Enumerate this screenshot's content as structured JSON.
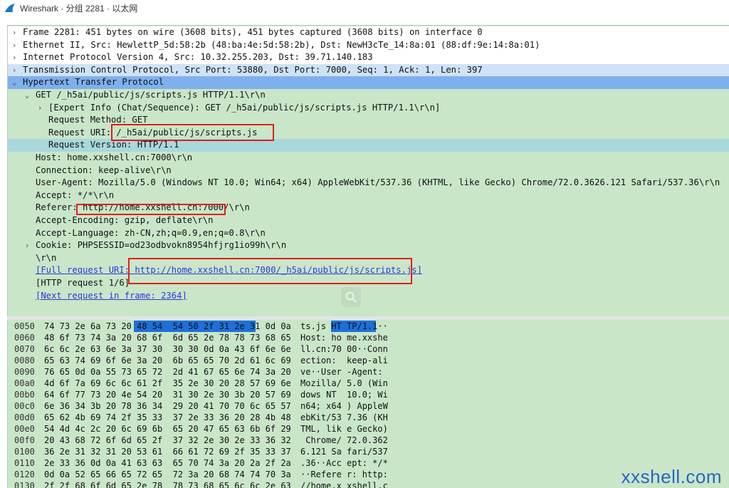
{
  "window": {
    "title": "Wireshark · 分组 2281 · 以太网"
  },
  "tree": {
    "rows": [
      "Frame 2281: 451 bytes on wire (3608 bits), 451 bytes captured (3608 bits) on interface 0",
      "Ethernet II, Src: HewlettP_5d:58:2b (48:ba:4e:5d:58:2b), Dst: NewH3cTe_14:8a:01 (88:df:9e:14:8a:01)",
      "Internet Protocol Version 4, Src: 10.32.255.203, Dst: 39.71.140.183",
      "Transmission Control Protocol, Src Port: 53880, Dst Port: 7000, Seq: 1, Ack: 1, Len: 397",
      "Hypertext Transfer Protocol",
      "GET /_h5ai/public/js/scripts.js HTTP/1.1\\r\\n",
      "[Expert Info (Chat/Sequence): GET /_h5ai/public/js/scripts.js HTTP/1.1\\r\\n]",
      "Request Method: GET",
      "Request URI: /_h5ai/public/js/scripts.js",
      "Request Version: HTTP/1.1",
      "Host: home.xxshell.cn:7000\\r\\n",
      "Connection: keep-alive\\r\\n",
      "User-Agent: Mozilla/5.0 (Windows NT 10.0; Win64; x64) AppleWebKit/537.36 (KHTML, like Gecko) Chrome/72.0.3626.121 Safari/537.36\\r\\n",
      "Accept: */*\\r\\n",
      "Referer: http://home.xxshell.cn:7000/\\r\\n",
      "Accept-Encoding: gzip, deflate\\r\\n",
      "Accept-Language: zh-CN,zh;q=0.9,en;q=0.8\\r\\n",
      "Cookie: PHPSESSID=od23odbvokn8954hfjrg1io99h\\r\\n",
      "\\r\\n",
      "[Full request URI: ",
      "http://home.xxshell.cn:7000/_h5ai/public/js/scripts.js",
      "]",
      "[HTTP request 1/6]",
      "[Next request in frame: 2364]"
    ]
  },
  "hex": {
    "rows": [
      {
        "offset": "0050",
        "bytes": "74 73 2e 6a 73 20 48 54  54 50 2f 31 2e 31 0d 0a",
        "ascii": "ts.js HT TP/1.1··"
      },
      {
        "offset": "0060",
        "bytes": "48 6f 73 74 3a 20 68 6f  6d 65 2e 78 78 73 68 65",
        "ascii": "Host: ho me.xxshe"
      },
      {
        "offset": "0070",
        "bytes": "6c 6c 2e 63 6e 3a 37 30  30 30 0d 0a 43 6f 6e 6e",
        "ascii": "ll.cn:70 00··Conn"
      },
      {
        "offset": "0080",
        "bytes": "65 63 74 69 6f 6e 3a 20  6b 65 65 70 2d 61 6c 69",
        "ascii": "ection:  keep-ali"
      },
      {
        "offset": "0090",
        "bytes": "76 65 0d 0a 55 73 65 72  2d 41 67 65 6e 74 3a 20",
        "ascii": "ve··User -Agent: "
      },
      {
        "offset": "00a0",
        "bytes": "4d 6f 7a 69 6c 6c 61 2f  35 2e 30 20 28 57 69 6e",
        "ascii": "Mozilla/ 5.0 (Win"
      },
      {
        "offset": "00b0",
        "bytes": "64 6f 77 73 20 4e 54 20  31 30 2e 30 3b 20 57 69",
        "ascii": "dows NT  10.0; Wi"
      },
      {
        "offset": "00c0",
        "bytes": "6e 36 34 3b 20 78 36 34  29 20 41 70 70 6c 65 57",
        "ascii": "n64; x64 ) AppleW"
      },
      {
        "offset": "00d0",
        "bytes": "65 62 4b 69 74 2f 35 33  37 2e 33 36 20 28 4b 48",
        "ascii": "ebKit/53 7.36 (KH"
      },
      {
        "offset": "00e0",
        "bytes": "54 4d 4c 2c 20 6c 69 6b  65 20 47 65 63 6b 6f 29",
        "ascii": "TML, lik e Gecko)"
      },
      {
        "offset": "00f0",
        "bytes": "20 43 68 72 6f 6d 65 2f  37 32 2e 30 2e 33 36 32",
        "ascii": " Chrome/ 72.0.362"
      },
      {
        "offset": "0100",
        "bytes": "36 2e 31 32 31 20 53 61  66 61 72 69 2f 35 33 37",
        "ascii": "6.121 Sa fari/537"
      },
      {
        "offset": "0110",
        "bytes": "2e 33 36 0d 0a 41 63 63  65 70 74 3a 20 2a 2f 2a",
        "ascii": ".36··Acc ept: */*"
      },
      {
        "offset": "0120",
        "bytes": "0d 0a 52 65 66 65 72 65  72 3a 20 68 74 74 70 3a",
        "ascii": "··Refere r: http:"
      },
      {
        "offset": "0130",
        "bytes": "2f 2f 68 6f 6d 65 2e 78  78 73 68 65 6c 6c 2e 63",
        "ascii": "//home.x xshell.c"
      }
    ]
  },
  "watermark": "xxshell.com",
  "colors": {
    "tree_bg": "#c9e6c9",
    "selected_row": "#7fb0ee",
    "highlight_row": "#a9d8dc",
    "annotation_box": "#e0201a",
    "link": "#2d39d6",
    "hex_highlight": "#1e6fd9"
  }
}
